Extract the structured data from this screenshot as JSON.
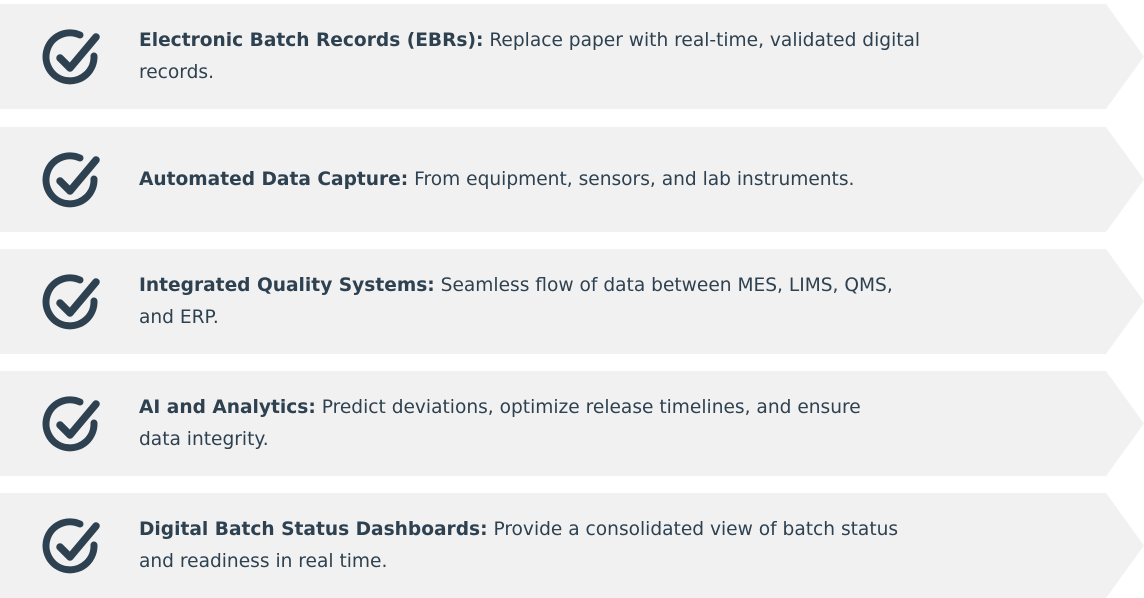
{
  "features": [
    {
      "title": "Electronic Batch Records (EBRs):",
      "description": "Replace paper with real-time, validated digital",
      "description_line2": "records.",
      "icon": "check-circle-icon"
    },
    {
      "title": "Automated Data Capture:",
      "description": "From equipment, sensors, and lab instruments.",
      "icon": "check-circle-icon"
    },
    {
      "title": "Integrated Quality Systems:",
      "description": "Seamless flow of data between MES, LIMS, QMS,",
      "description_line2": "and ERP.",
      "icon": "check-circle-icon"
    },
    {
      "title": "AI and Analytics:",
      "description": "Predict deviations, optimize release timelines, and ensure",
      "description_line2": "data integrity.",
      "icon": "check-circle-icon"
    },
    {
      "title": "Digital Batch Status Dashboards:",
      "description": "Provide a consolidated view of batch status",
      "description_line2": "and readiness in real time.",
      "icon": "check-circle-icon"
    }
  ],
  "colors": {
    "card_background": "#f1f1f1",
    "text": "#2e4150",
    "icon": "#2e4150"
  }
}
